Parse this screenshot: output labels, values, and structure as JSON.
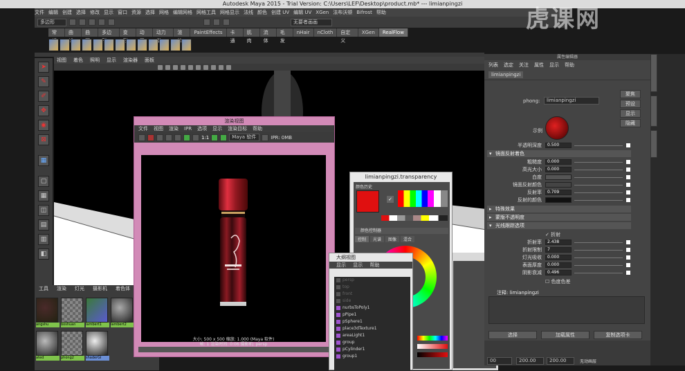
{
  "titlebar": {
    "text": "Autodesk Maya 2015 - Trial Version: C:\\Users\\LEF\\Desktop\\product.mb*  ---  limianpingzi"
  },
  "menubar": {
    "items": [
      "文件",
      "编辑",
      "创建",
      "选择",
      "修改",
      "显示",
      "窗口",
      "资源",
      "选择",
      "网格",
      "编辑网格",
      "网格工具",
      "网格显示",
      "法线",
      "颜色",
      "创建 UV",
      "编辑 UV",
      "XGen",
      "法布沃顿",
      "Bifrost",
      "帮助"
    ]
  },
  "statusline": {
    "mode": "多边形",
    "search_placeholder": "无要者画画"
  },
  "shelf": {
    "tabs": [
      "常规",
      "曲线",
      "曲面",
      "多边形",
      "变形",
      "动画",
      "动力学",
      "渲染",
      "PaintEffects",
      "卡通",
      "肌肉",
      "流体",
      "毛发",
      "nHair",
      "nCloth",
      "自定义",
      "XGen",
      "RealFlow"
    ],
    "active": "RealFlow"
  },
  "panel": {
    "menu": [
      "视图",
      "着色",
      "照明",
      "显示",
      "渲染器",
      "面板"
    ]
  },
  "watermark": {
    "text": "虎课网"
  },
  "hypershade": {
    "tabs": [
      "工具",
      "渲染",
      "灯光",
      "摄影机",
      "着色体"
    ],
    "swatches": [
      {
        "label": "angshu"
      },
      {
        "label": "boshuan"
      },
      {
        "label": "lambert1"
      },
      {
        "label": "lambert2"
      },
      {
        "label": "ated"
      },
      {
        "label": "phong2"
      },
      {
        "label": "shaderGl"
      }
    ]
  },
  "render_view": {
    "title": "渲染视图",
    "menu": [
      "文件",
      "视图",
      "渲染",
      "IPR",
      "选项",
      "显示",
      "渲染目标",
      "帮助"
    ],
    "ratio": "1:1",
    "renderer": "Maya 软件",
    "ipr": "IPR: 0MB",
    "status_line1": "大小: 500 x 500  缩放: 1.000         (Maya 软件)",
    "status_line2": "帧: 1        渲染时间: 0:06       摄影机: persp"
  },
  "transparency": {
    "title": "limianpingzi.transparency",
    "history_label": "颜色历史",
    "picker_label": "颜色控制器",
    "tabs": [
      "控制",
      "光谱",
      "图像",
      "混合"
    ],
    "current_color": "#e01010"
  },
  "outliner": {
    "title": "大纲视图",
    "menu": [
      "显示",
      "显示",
      "帮助"
    ],
    "items": [
      {
        "name": "persp",
        "dim": true
      },
      {
        "name": "top",
        "dim": true
      },
      {
        "name": "front",
        "dim": true
      },
      {
        "name": "side",
        "dim": true
      },
      {
        "name": "nurbsToPoly1",
        "dim": false
      },
      {
        "name": "pPipe1",
        "dim": false
      },
      {
        "name": "pSphere1",
        "dim": false
      },
      {
        "name": "place3dTexture1",
        "dim": false
      },
      {
        "name": "areaLight1",
        "dim": false
      },
      {
        "name": "group",
        "dim": false
      },
      {
        "name": "pCylinder1",
        "dim": false
      },
      {
        "name": "group1",
        "dim": false
      }
    ]
  },
  "attribute_editor": {
    "title": "属性编辑器",
    "menu": [
      "列表",
      "选定",
      "关注",
      "属性",
      "显示",
      "帮助"
    ],
    "tab": "limianpingzi",
    "shader_type": "phong:",
    "shader_name": "limianpingzi",
    "focus_btn": "聚焦",
    "preset_btn": "预设",
    "show_btn": "显示",
    "hide_btn": "隐藏",
    "sample_label": "示例",
    "partial_row": "半透明深度",
    "partial_val": "0.500",
    "spec_section": "镜面反射着色",
    "spec_rows": [
      {
        "label": "粗糙度",
        "value": "0.000"
      },
      {
        "label": "高光大小",
        "value": "0.000"
      },
      {
        "label": "白度",
        "value": ""
      },
      {
        "label": "镜面反射颜色",
        "value": ""
      },
      {
        "label": "反射率",
        "value": "0.709"
      },
      {
        "label": "反射的颜色",
        "value": ""
      }
    ],
    "special_section": "特殊效果",
    "matte_section": "蒙版不透明度",
    "raytrace_section": "光线跟踪选项",
    "refraction_check": "折射",
    "ray_rows": [
      {
        "label": "折射率",
        "value": "2.438"
      },
      {
        "label": "折射限制",
        "value": "7"
      },
      {
        "label": "灯光吸收",
        "value": "0.000"
      },
      {
        "label": "表面厚度",
        "value": "0.000"
      },
      {
        "label": "阴影衰减",
        "value": "0.496"
      }
    ],
    "chromatic_check": "色度色差",
    "note_label": "注释: limianpingzi",
    "select_btn": "选择",
    "load_btn": "加载属性",
    "copy_btn": "复制选项卡"
  },
  "timeline": {
    "start": "00",
    "current": "200.00",
    "end": "200.00",
    "anim_layer": "无动画层"
  }
}
